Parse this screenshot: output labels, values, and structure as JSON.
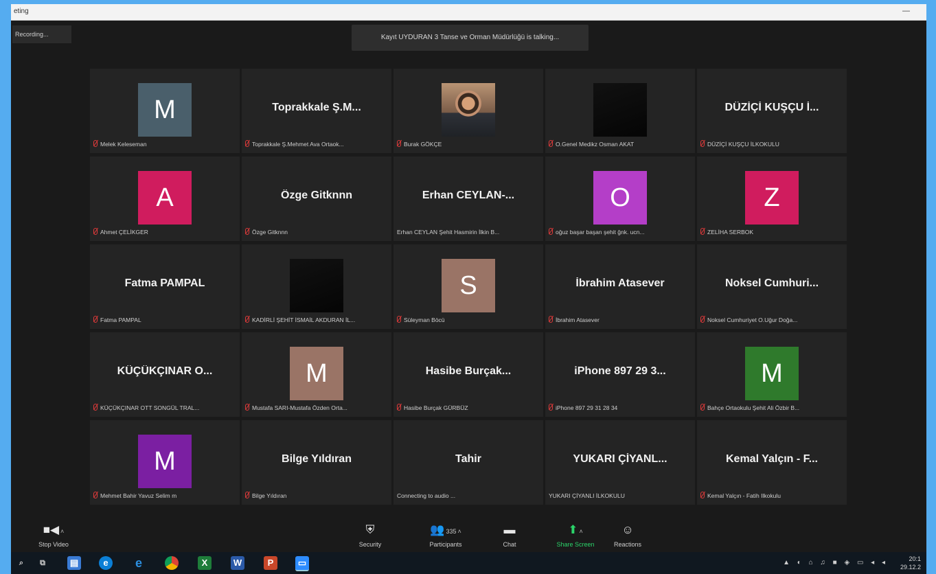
{
  "window": {
    "title": "eting",
    "minimize": "—"
  },
  "recording": "Recording...",
  "talking": "Kayıt UYDURAN 3 Tanse ve Orman Müdürlüğü is talking...",
  "tiles": [
    {
      "type": "avatar",
      "letter": "M",
      "color": "#4a5f6b",
      "footer": "Melek Keleseman"
    },
    {
      "type": "text",
      "big": "Toprakkale Ş.M...",
      "footer": "Toprakkale Ş.Mehmet Ava Ortaok..."
    },
    {
      "type": "photo",
      "footer": "Burak GÖKÇE"
    },
    {
      "type": "black",
      "footer": "O.Genel Medikz Osman AKAT"
    },
    {
      "type": "text",
      "big": "DÜZİÇİ KUŞÇU İ...",
      "footer": "DÜZİÇİ KUŞÇU İLKOKULU"
    },
    {
      "type": "avatar",
      "letter": "A",
      "color": "#d01c5e",
      "footer": "Ahmet ÇELİKGER"
    },
    {
      "type": "text",
      "big": "Özge Gitknnn",
      "footer": "Özge Gitknnn"
    },
    {
      "type": "text",
      "big": "Erhan CEYLAN-...",
      "footer": "Erhan CEYLAN Şehit Hasmirin İlkin B...",
      "nomic": true
    },
    {
      "type": "avatar",
      "letter": "O",
      "color": "#b43ec8",
      "footer": "oğuz başar başan şehit ğnk. ucn..."
    },
    {
      "type": "avatar",
      "letter": "Z",
      "color": "#d01c5e",
      "footer": "ZELİHA SERBOK"
    },
    {
      "type": "text",
      "big": "Fatma PAMPAL",
      "footer": "Fatma PAMPAL"
    },
    {
      "type": "black",
      "footer": "KADİRLİ ŞEHİT İSMAİL AKDURAN İL..."
    },
    {
      "type": "avatar",
      "letter": "S",
      "color": "#9a7466",
      "footer": "Süleyman Böcü"
    },
    {
      "type": "text",
      "big": "İbrahim Atasever",
      "footer": "İbrahim Atasever"
    },
    {
      "type": "text",
      "big": "Noksel Cumhuri...",
      "footer": "Noksel Cumhuriyet O.Uğur Doğa..."
    },
    {
      "type": "text",
      "big": "KÜÇÜKÇINAR O...",
      "footer": "KÜÇÜKÇINAR OTT SONGÜL TRAL..."
    },
    {
      "type": "avatar",
      "letter": "M",
      "color": "#9a7466",
      "footer": "Mustafa SARI-Mustafa Özden Orta..."
    },
    {
      "type": "text",
      "big": "Hasibe Burçak...",
      "footer": "Hasibe Burçak GÜRBÜZ"
    },
    {
      "type": "text",
      "big": "iPhone 897 29 3...",
      "footer": "iPhone 897 29 31 28 34"
    },
    {
      "type": "avatar",
      "letter": "M",
      "color": "#2f7a2c",
      "footer": "Bahçe Ortaokulu Şehit Ali Özbir B..."
    },
    {
      "type": "avatar",
      "letter": "M",
      "color": "#7b1fa2",
      "footer": "Mehmet Bahir Yavuz Selim m"
    },
    {
      "type": "text",
      "big": "Bilge Yıldıran",
      "footer": "Bilge Yıldıran"
    },
    {
      "type": "text",
      "big": "Tahir",
      "footer": "Connecting to audio ...",
      "nomic": true
    },
    {
      "type": "text",
      "big": "YUKARI ÇİYANL...",
      "footer": "YUKARI ÇİYANLI İLKOKULU",
      "nomic": true
    },
    {
      "type": "text",
      "big": "Kemal Yalçın - F...",
      "footer": "Kemal Yalçın - Fatih Ilkokulu"
    }
  ],
  "toolbar": {
    "stop_video": {
      "icon": "camera-icon",
      "label": "Stop Video"
    },
    "security": {
      "icon": "shield-icon",
      "label": "Security"
    },
    "participants": {
      "icon": "people-icon",
      "label": "Participants",
      "count": "335"
    },
    "chat": {
      "icon": "chat-icon",
      "label": "Chat"
    },
    "share": {
      "icon": "share-screen-icon",
      "label": "Share Screen",
      "color": "#2bd46a"
    },
    "reactions": {
      "icon": "reactions-icon",
      "label": "Reactions"
    }
  },
  "taskbar": {
    "clock_time": "20:1",
    "clock_date": "29.12.2"
  }
}
